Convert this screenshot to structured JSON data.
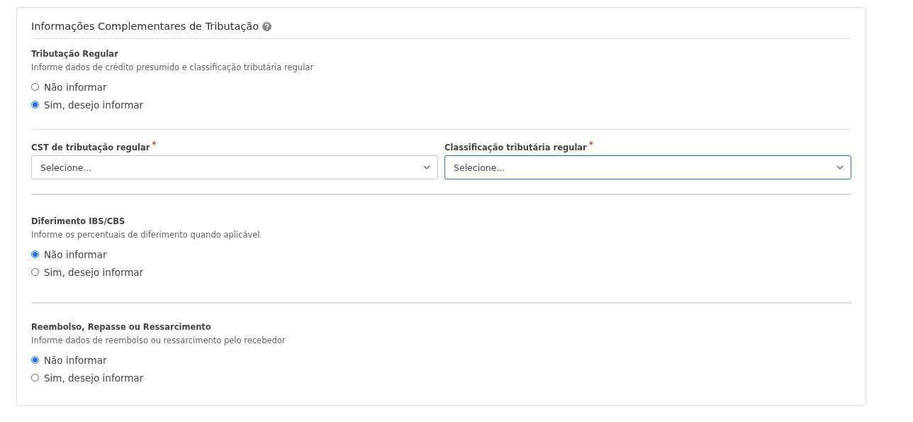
{
  "title": "Informações Complementares de Tributação",
  "blocks": [
    {
      "kind": "radio-group",
      "heading": "Tributação Regular",
      "description": "Informe dados de crédito presumido e classificação tributária regular",
      "strong_divider": false,
      "options": [
        {
          "label": "Não informar",
          "selected": false
        },
        {
          "label": "Sim, desejo informar",
          "selected": true
        }
      ]
    },
    {
      "kind": "selects",
      "strong_divider": true,
      "fields": [
        {
          "label": "CST de tributação regular",
          "marker": "*",
          "placeholder": "Selecione...",
          "focused": false
        },
        {
          "label": "Classificação tributária regular",
          "marker": "*",
          "placeholder": "Selecione...",
          "focused": true
        }
      ]
    },
    {
      "kind": "radio-group",
      "heading": "Diferimento IBS/CBS",
      "description": "Informe os percentuais de diferimento quando aplicável",
      "strong_divider": true,
      "options": [
        {
          "label": "Não informar",
          "selected": true
        },
        {
          "label": "Sim, desejo informar",
          "selected": false
        }
      ]
    },
    {
      "kind": "radio-group",
      "heading": "Reembolso, Repasse ou Ressarcimento",
      "description": "Informe dados de reembolso ou ressarcimento pelo recebedor",
      "options": [
        {
          "label": "Não informar",
          "selected": true
        },
        {
          "label": "Sim, desejo informar",
          "selected": false
        }
      ]
    }
  ]
}
